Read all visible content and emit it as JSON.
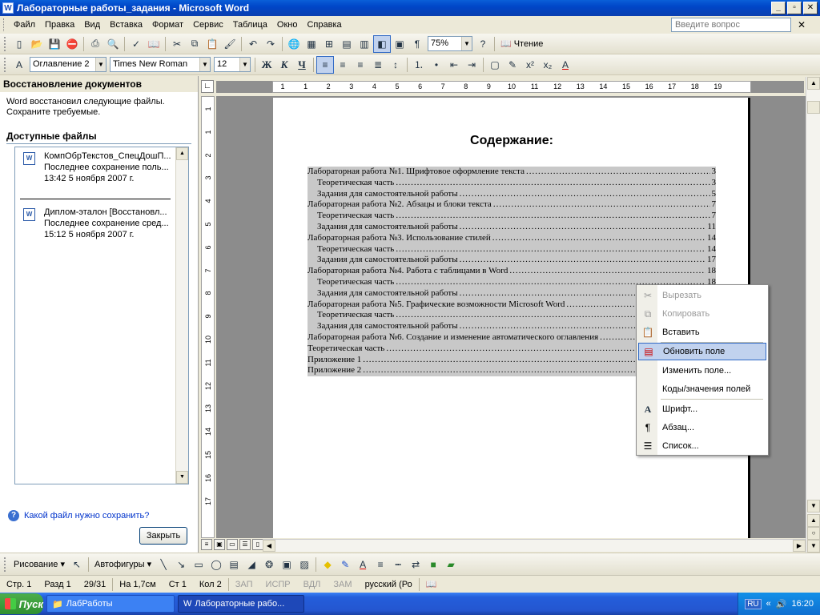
{
  "window": {
    "title": "Лабораторные работы_задания - Microsoft Word",
    "app_icon": "W",
    "minimize": "_",
    "maximize": "▫",
    "close": "✕"
  },
  "menu": {
    "items": [
      "Файл",
      "Правка",
      "Вид",
      "Вставка",
      "Формат",
      "Сервис",
      "Таблица",
      "Окно",
      "Справка"
    ],
    "ask_placeholder": "Введите вопрос",
    "close": "✕"
  },
  "standard_toolbar": {
    "zoom": "75%",
    "reading_label": "Чтение"
  },
  "formatting_toolbar": {
    "style": "Оглавление 2",
    "font": "Times New Roman",
    "size": "12",
    "bold": "Ж",
    "italic": "К",
    "underline": "Ч"
  },
  "task_pane": {
    "title": "Восстановление документов",
    "intro": "Word восстановил следующие файлы. Сохраните требуемые.",
    "available_label": "Доступные файлы",
    "files": [
      {
        "name": "КомпОбрТекстов_СпецДошП...",
        "status": "Последнее сохранение поль...",
        "time": "13:42 5 ноября 2007 г."
      },
      {
        "name": "Диплом-эталон  [Восстановл...",
        "status": "Последнее сохранение сред...",
        "time": "15:12 5 ноября 2007 г."
      }
    ],
    "help_link": "Какой файл нужно сохранить?",
    "close_button": "Закрыть"
  },
  "ruler": {
    "h_numbers": [
      "1",
      "1",
      "2",
      "3",
      "4",
      "5",
      "6",
      "7",
      "8",
      "9",
      "10",
      "11",
      "12",
      "13",
      "14",
      "15",
      "16",
      "17",
      "18",
      "19"
    ],
    "v_numbers": [
      "1",
      "1",
      "2",
      "3",
      "4",
      "5",
      "6",
      "7",
      "8",
      "9",
      "10",
      "11",
      "12",
      "13",
      "14",
      "15",
      "16",
      "17"
    ]
  },
  "document": {
    "heading": "Содержание:",
    "toc": [
      {
        "text": "Лабораторная работа №1. Шрифтовое оформление текста",
        "page": "3",
        "level": 1
      },
      {
        "text": "Теоретическая часть",
        "page": "3",
        "level": 2
      },
      {
        "text": "Задания для самостоятельной работы",
        "page": "5",
        "level": 2
      },
      {
        "text": "Лабораторная работа №2. Абзацы и блоки текста",
        "page": "7",
        "level": 1
      },
      {
        "text": "Теоретическая часть",
        "page": "7",
        "level": 2
      },
      {
        "text": "Задания для самостоятельной работы",
        "page": "11",
        "level": 2
      },
      {
        "text": "Лабораторная работа №3. Использование стилей",
        "page": "14",
        "level": 1
      },
      {
        "text": "Теоретическая часть",
        "page": "14",
        "level": 2
      },
      {
        "text": "Задания для самостоятельной работы",
        "page": "17",
        "level": 2
      },
      {
        "text": "Лабораторная работа №4. Работа с таблицами в Word",
        "page": "18",
        "level": 1
      },
      {
        "text": "Теоретическая часть",
        "page": "18",
        "level": 2
      },
      {
        "text": "Задания для самостоятельной работы",
        "page": "",
        "level": 2
      },
      {
        "text": "Лабораторная работа №5. Графические возможности Microsoft Word",
        "page": "",
        "level": 1
      },
      {
        "text": "Теоретическая часть",
        "page": "",
        "level": 2
      },
      {
        "text": "Задания для самостоятельной работы",
        "page": "",
        "level": 2
      },
      {
        "text": "Лабораторная работа №6. Создание и изменение автоматического оглавления",
        "page": "",
        "level": 1
      },
      {
        "text": "Теоретическая часть",
        "page": "",
        "level": 1
      },
      {
        "text": "Приложение 1",
        "page": "",
        "level": 1
      },
      {
        "text": "Приложение 2",
        "page": "",
        "level": 1
      }
    ]
  },
  "context_menu": {
    "items": [
      {
        "label": "Вырезать",
        "icon": "scissors-icon",
        "state": "disabled"
      },
      {
        "label": "Копировать",
        "icon": "copy-icon",
        "state": "disabled"
      },
      {
        "label": "Вставить",
        "icon": "paste-icon",
        "state": "enabled"
      },
      {
        "label": "Обновить поле",
        "icon": "update-field-icon",
        "state": "highlighted"
      },
      {
        "label": "Изменить поле...",
        "icon": "",
        "state": "enabled"
      },
      {
        "label": "Коды/значения полей",
        "icon": "",
        "state": "enabled"
      },
      {
        "label": "Шрифт...",
        "icon": "font-icon",
        "state": "enabled"
      },
      {
        "label": "Абзац...",
        "icon": "paragraph-icon",
        "state": "enabled"
      },
      {
        "label": "Список...",
        "icon": "list-icon",
        "state": "enabled"
      }
    ]
  },
  "drawing_toolbar": {
    "draw": "Рисование ▾",
    "autoshapes": "Автофигуры ▾"
  },
  "status_bar": {
    "page": "Стр.  1",
    "section": "Разд  1",
    "pages": "29/31",
    "at": "На 1,7см",
    "line": "Ст  1",
    "col": "Кол  2",
    "rec": "ЗАП",
    "trk": "ИСПР",
    "ext": "ВДЛ",
    "ovr": "ЗАМ",
    "language": "русский (Ро"
  },
  "taskbar": {
    "start": "Пуск",
    "items": [
      "ЛабРаботы",
      "Лабораторные рабо..."
    ],
    "lang": "RU",
    "clock": "16:20"
  },
  "colors": {
    "titlebar": "#0a5fd8",
    "highlight": "#c1d2ee",
    "taskbar": "#245edb"
  }
}
